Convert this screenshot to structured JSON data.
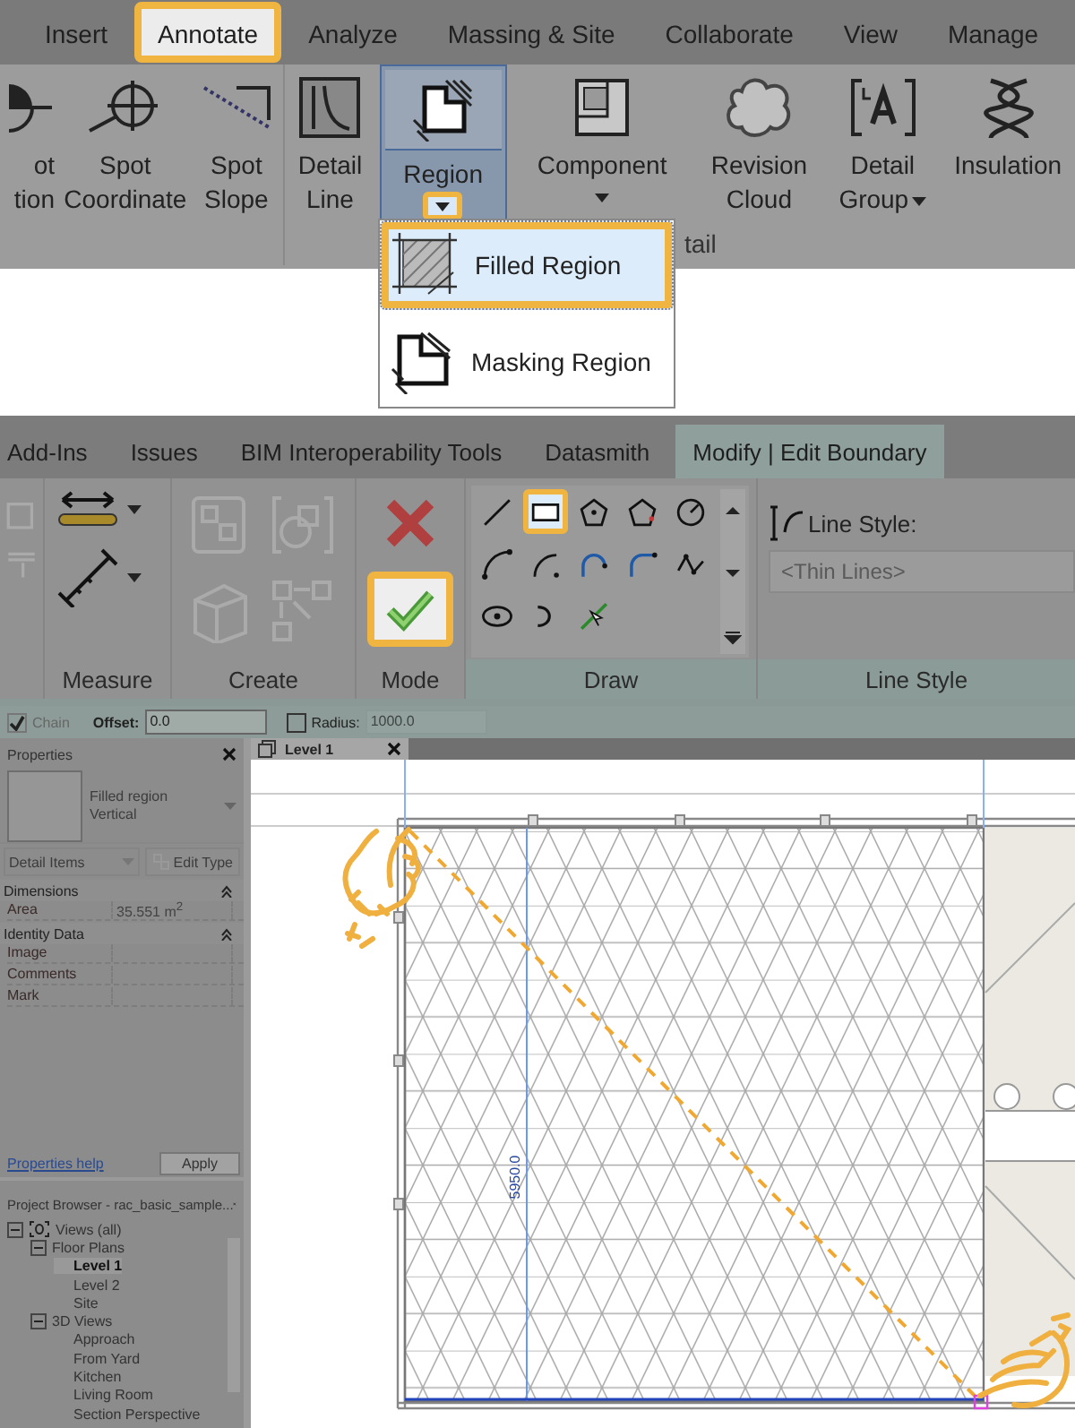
{
  "annotate_ribbon": {
    "tabs": [
      {
        "label": "Insert",
        "selected": false,
        "highlighted": false
      },
      {
        "label": "Annotate",
        "selected": true,
        "highlighted": true
      },
      {
        "label": "Analyze",
        "selected": false,
        "highlighted": false
      },
      {
        "label": "Massing & Site",
        "selected": false,
        "highlighted": false
      },
      {
        "label": "Collaborate",
        "selected": false,
        "highlighted": false
      },
      {
        "label": "View",
        "selected": false,
        "highlighted": false
      },
      {
        "label": "Manage",
        "selected": false,
        "highlighted": false
      }
    ],
    "tools": [
      {
        "kind": "spot_elevation",
        "lines": [
          "ot",
          "tion"
        ],
        "selected": false
      },
      {
        "kind": "spot_coordinate",
        "lines": [
          "Spot",
          "Coordinate"
        ],
        "selected": false
      },
      {
        "kind": "spot_slope",
        "lines": [
          "Spot",
          "Slope"
        ],
        "selected": false
      },
      {
        "kind": "detail_line",
        "lines": [
          "Detail",
          "Line"
        ],
        "selected": false
      },
      {
        "kind": "region",
        "lines": [
          "Region"
        ],
        "selected": true,
        "dropdown_below": true,
        "menu_highlighted": true
      },
      {
        "kind": "component",
        "lines": [
          "Component"
        ],
        "selected": false,
        "dropdown_below": true,
        "menu_highlighted": false
      },
      {
        "kind": "revision_cloud",
        "lines": [
          "Revision",
          "Cloud"
        ],
        "selected": false
      },
      {
        "kind": "detail_group",
        "lines": [
          "Detail",
          "Group"
        ],
        "selected": false,
        "dropdown_side": true
      },
      {
        "kind": "insulation",
        "lines": [
          "Insulation"
        ],
        "selected": false
      }
    ],
    "panel_label": "tail",
    "region_menu": [
      {
        "kind": "filled",
        "label": "Filled Region",
        "selected": true,
        "highlighted": true
      },
      {
        "kind": "masking",
        "label": "Masking Region",
        "selected": false,
        "highlighted": false
      }
    ]
  },
  "modify_ribbon": {
    "tabs": [
      {
        "label": "Add-Ins",
        "selected": false
      },
      {
        "label": "Issues",
        "selected": false
      },
      {
        "label": "BIM Interoperability Tools",
        "selected": false
      },
      {
        "label": "Datasmith",
        "selected": false
      },
      {
        "label": "Modify | Edit Boundary",
        "selected": true
      }
    ],
    "measure": {
      "label": "Measure"
    },
    "create": {
      "label": "Create"
    },
    "mode": {
      "label": "Mode",
      "buttons": [
        {
          "kind": "cancel",
          "highlighted": false
        },
        {
          "kind": "finish",
          "highlighted": true
        }
      ]
    },
    "draw": {
      "label": "Draw",
      "tools": [
        {
          "kind": "line",
          "selected": false,
          "highlighted": false
        },
        {
          "kind": "rectangle",
          "selected": true,
          "highlighted": true
        },
        {
          "kind": "inscribed_polygon",
          "selected": false,
          "highlighted": false
        },
        {
          "kind": "circumscribed_polygon",
          "selected": false,
          "highlighted": false
        },
        {
          "kind": "circle",
          "selected": false,
          "highlighted": false
        },
        {
          "kind": "start_end_arc",
          "selected": false,
          "highlighted": false
        },
        {
          "kind": "center_arc",
          "selected": false,
          "highlighted": false
        },
        {
          "kind": "tangent_arc",
          "selected": false,
          "highlighted": false
        },
        {
          "kind": "fillet_arc",
          "selected": false,
          "highlighted": false
        },
        {
          "kind": "spline",
          "selected": false,
          "highlighted": false
        },
        {
          "kind": "ellipse",
          "selected": false,
          "highlighted": false
        },
        {
          "kind": "partial_ellipse",
          "selected": false,
          "highlighted": false
        },
        {
          "kind": "pick_lines",
          "selected": false,
          "highlighted": false
        }
      ]
    },
    "line_style": {
      "label": "Line Style",
      "field_label": "Line Style:",
      "value": "<Thin Lines>"
    }
  },
  "options_bar": {
    "chain": {
      "label": "Chain",
      "checked": true,
      "disabled": true
    },
    "offset": {
      "label": "Offset:",
      "value": "0.0"
    },
    "radius": {
      "label": "Radius:",
      "checked": false
    },
    "radius_value": {
      "value": "1000.0",
      "disabled": true
    }
  },
  "properties": {
    "title": "Properties",
    "type_lines": [
      "Filled region",
      "Vertical"
    ],
    "category": "Detail Items",
    "edit_type": "Edit Type",
    "groups": [
      {
        "label": "Dimensions",
        "rows": [
          {
            "name": "Area",
            "value": "35.551 m$^{2}$"
          }
        ]
      },
      {
        "label": "Identity Data",
        "rows": [
          {
            "name": "Image",
            "value": ""
          },
          {
            "name": "Comments",
            "value": ""
          },
          {
            "name": "Mark",
            "value": ""
          }
        ]
      }
    ],
    "help_link": "Properties help",
    "apply": "Apply"
  },
  "project_browser": {
    "title": "Project Browser - rac_basic_sample...",
    "tree": [
      {
        "label": "Views (all)",
        "expanded": true,
        "children": [
          {
            "label": "Floor Plans",
            "expanded": true,
            "children": [
              {
                "label": "Level 1",
                "selected": true
              },
              {
                "label": "Level 2",
                "selected": false
              },
              {
                "label": "Site",
                "selected": false
              }
            ]
          },
          {
            "label": "3D Views",
            "expanded": true,
            "children": [
              {
                "label": "Approach",
                "selected": false
              },
              {
                "label": "From Yard",
                "selected": false
              },
              {
                "label": "Kitchen",
                "selected": false
              },
              {
                "label": "Living Room",
                "selected": false
              },
              {
                "label": "Section Perspective",
                "selected": false
              }
            ]
          }
        ]
      }
    ]
  },
  "view_tab": {
    "label": "Level 1"
  },
  "canvas": {
    "dimension": "5950.0"
  }
}
